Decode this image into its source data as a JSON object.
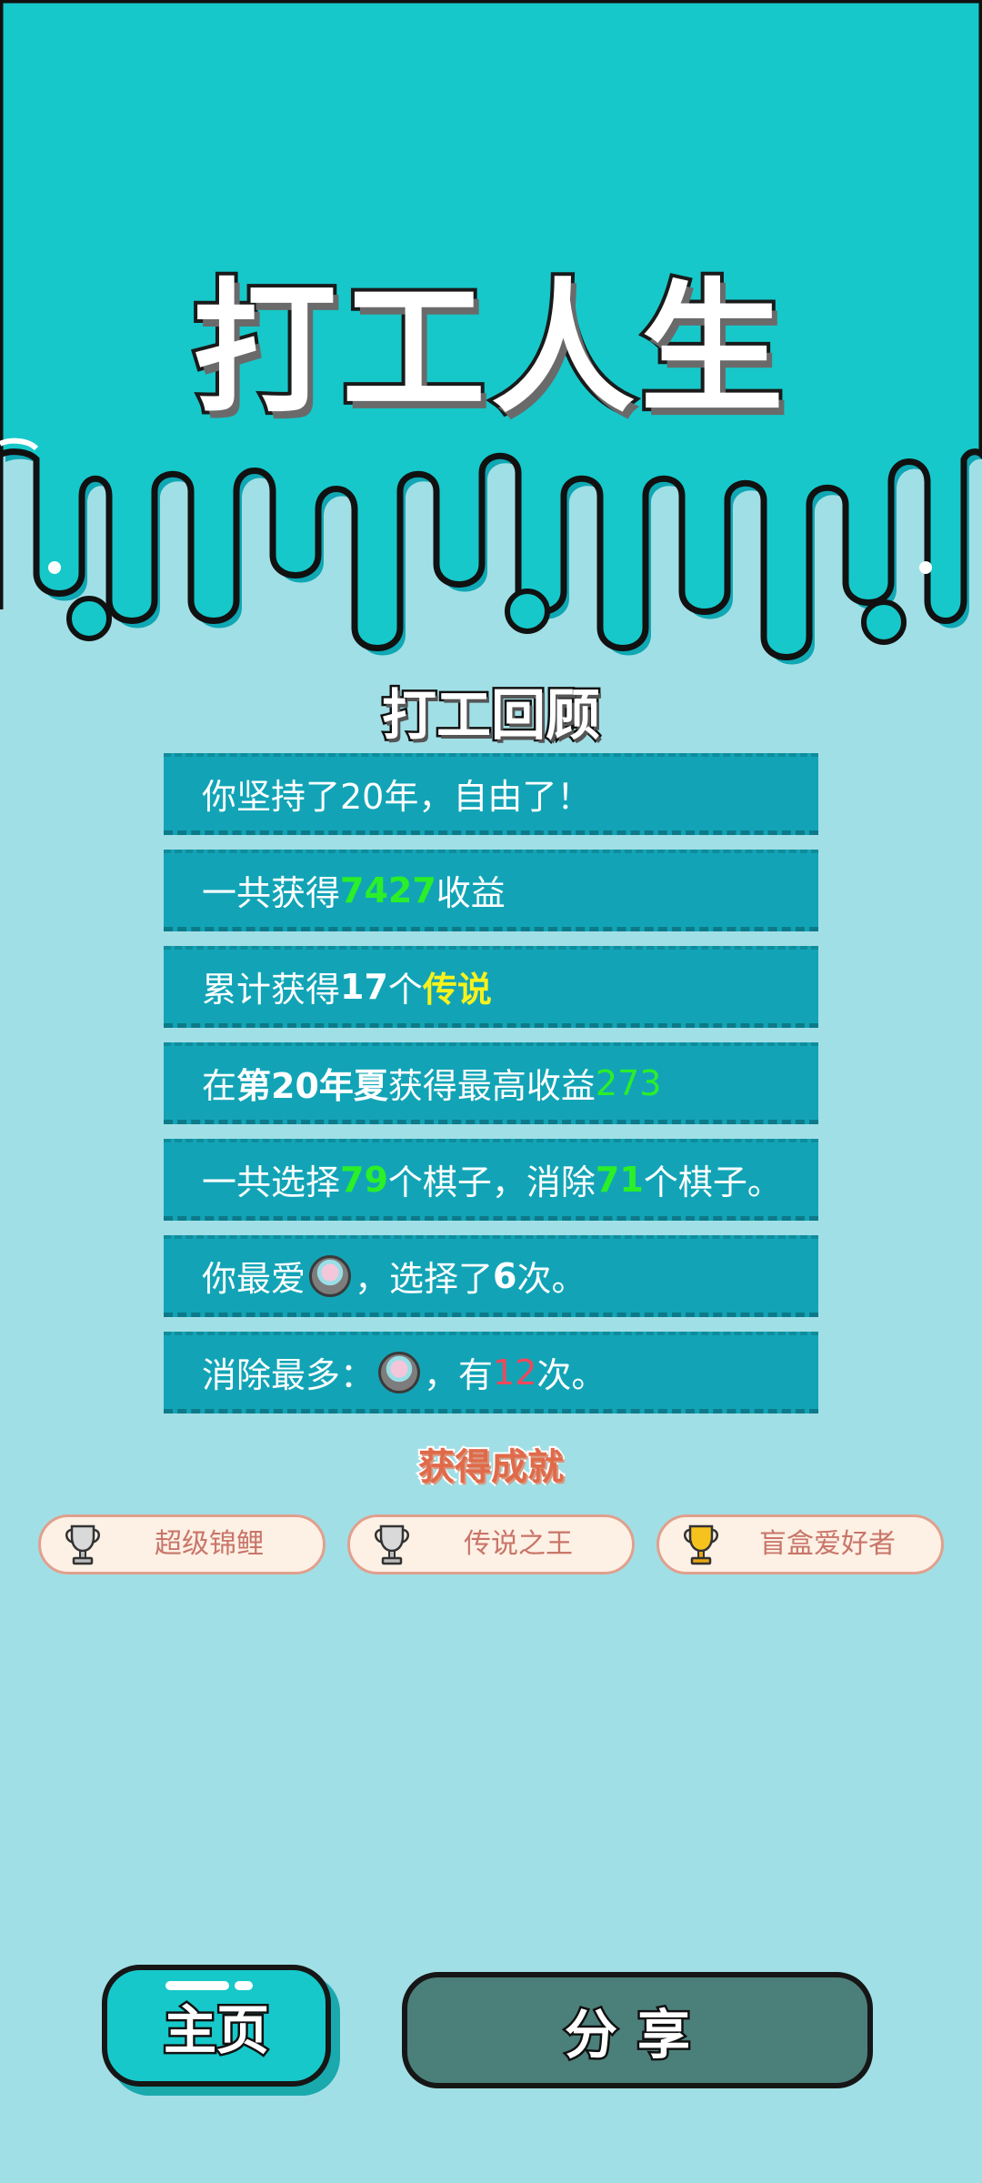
{
  "header": {
    "title": "打工人生"
  },
  "review": {
    "title": "打工回顾",
    "rows": [
      {
        "text": "你坚持了20年，自由了！"
      },
      {
        "pre": "一共获得",
        "value": "7427",
        "post": "收益"
      },
      {
        "pre": "累计获得",
        "count": "17",
        "mid": "个",
        "highlight": "传说"
      },
      {
        "pre": "在 ",
        "bold": "第20年夏",
        "mid": " 获得最高收益",
        "value": "273"
      },
      {
        "pre": "一共选择",
        "v1": "79",
        "mid": "个棋子，消除",
        "v2": "71",
        "post": "个棋子。"
      },
      {
        "pre": "你最爱",
        "icon": "blind-box-icon",
        "mid": "，选择了",
        "count": "6",
        "post": "次。"
      },
      {
        "pre": "消除最多：",
        "icon": "blind-box-icon",
        "mid": "，有",
        "count": "12",
        "post": "次。"
      }
    ]
  },
  "achievements": {
    "title": "获得成就",
    "items": [
      {
        "label": "超级锦鲤",
        "icon": "trophy-silver-icon"
      },
      {
        "label": "传说之王",
        "icon": "trophy-silver-icon"
      },
      {
        "label": "盲盒爱好者",
        "icon": "trophy-gold-icon"
      }
    ]
  },
  "buttons": {
    "home": "主页",
    "share": "分享"
  },
  "colors": {
    "header_bg": "#16c8ca",
    "page_bg": "#a1dfe6",
    "row_bg": "#12a4b6",
    "green_value": "#2bef28",
    "yellow_value": "#f7f21c",
    "red_value": "#f0485a",
    "share_button": "#4b7f7a"
  }
}
